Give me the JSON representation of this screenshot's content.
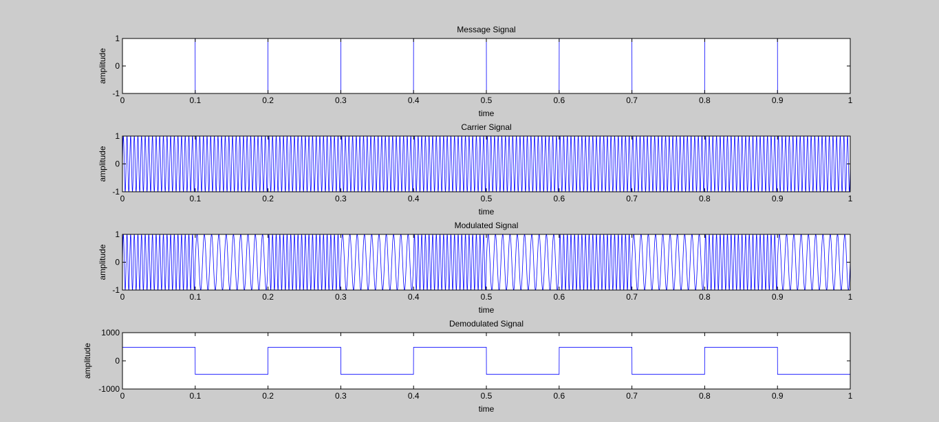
{
  "chart_data": [
    {
      "type": "line",
      "title": "Message Signal",
      "xlabel": "time",
      "ylabel": "amplitude",
      "xlim": [
        0,
        1
      ],
      "ylim": [
        -1,
        1
      ],
      "xticks": [
        "0",
        "0.1",
        "0.2",
        "0.3",
        "0.4",
        "0.5",
        "0.6",
        "0.7",
        "0.8",
        "0.9",
        "1"
      ],
      "yticks": [
        "-1",
        "0",
        "1"
      ],
      "grid": false,
      "series_color": "#0000ff",
      "signal": {
        "kind": "square",
        "amplitude": 1,
        "period": 0.2,
        "duty": 0.5,
        "start_level": 1
      }
    },
    {
      "type": "line",
      "title": "Carrier Signal",
      "xlabel": "time",
      "ylabel": "amplitude",
      "xlim": [
        0,
        1
      ],
      "ylim": [
        -1,
        1
      ],
      "xticks": [
        "0",
        "0.1",
        "0.2",
        "0.3",
        "0.4",
        "0.5",
        "0.6",
        "0.7",
        "0.8",
        "0.9",
        "1"
      ],
      "yticks": [
        "-1",
        "0",
        "1"
      ],
      "grid": false,
      "series_color": "#0000ff",
      "signal": {
        "kind": "sine",
        "amplitude": 1,
        "frequency": 200
      }
    },
    {
      "type": "line",
      "title": "Modulated Signal",
      "xlabel": "time",
      "ylabel": "amplitude",
      "xlim": [
        0,
        1
      ],
      "ylim": [
        -1,
        1
      ],
      "xticks": [
        "0",
        "0.1",
        "0.2",
        "0.3",
        "0.4",
        "0.5",
        "0.6",
        "0.7",
        "0.8",
        "0.9",
        "1"
      ],
      "yticks": [
        "-1",
        "0",
        "1"
      ],
      "grid": false,
      "series_color": "#0000ff",
      "signal": {
        "kind": "fsk",
        "amplitude": 1,
        "frequency_high": 200,
        "frequency_low": 100,
        "period": 0.2
      }
    },
    {
      "type": "line",
      "title": "Demodulated Signal",
      "xlabel": "time",
      "ylabel": "amplitude",
      "xlim": [
        0,
        1
      ],
      "ylim": [
        -1000,
        1000
      ],
      "xticks": [
        "0",
        "0.1",
        "0.2",
        "0.3",
        "0.4",
        "0.5",
        "0.6",
        "0.7",
        "0.8",
        "0.9",
        "1"
      ],
      "yticks": [
        "-1000",
        "0",
        "1000"
      ],
      "grid": false,
      "series_color": "#0000ff",
      "signal": {
        "kind": "square",
        "amplitude": 480,
        "period": 0.2,
        "duty": 0.5,
        "start_level": 480
      }
    }
  ]
}
